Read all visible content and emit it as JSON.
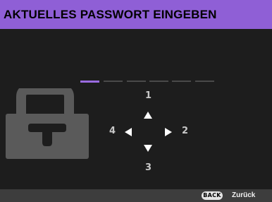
{
  "title": "AKTUELLES PASSWORT EINGEBEN",
  "password": {
    "slot_count": 6,
    "active_slot": 1
  },
  "keypad": {
    "up": "1",
    "right": "2",
    "down": "3",
    "left": "4"
  },
  "footer": {
    "back_key": "BACK",
    "back_label": "Zurück"
  },
  "colors": {
    "accent": "#8f5fd6",
    "active_slot": "#9a6be0",
    "background": "#1d1d1d",
    "lock_icon": "#5a5a5a",
    "footer_bar": "#3d3d3d"
  },
  "icons": {
    "lock": "lock-icon",
    "up": "arrow-up-icon",
    "down": "arrow-down-icon",
    "left": "arrow-left-icon",
    "right": "arrow-right-icon"
  }
}
